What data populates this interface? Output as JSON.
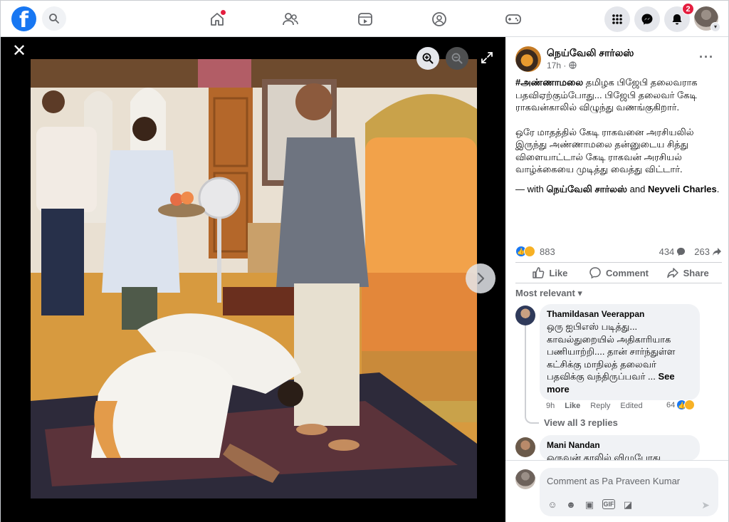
{
  "topbar": {
    "logo_letter": "f",
    "notification_count": "2"
  },
  "viewer": {
    "close_symbol": "✕"
  },
  "post": {
    "author": "நெய்வேலி சார்லஸ்",
    "time": "17h ·",
    "more": "···",
    "hashtag": "#அண்ணாமலை",
    "line1_rest": " தமிழக பிஜேபி தலைவராக பதவிஏற்கும்போது... பிஜேபி தலைவர் கேடி ராகவன்காலில் விழுந்து வணங்குகிறார்.",
    "paragraph2": "ஒரே மாதத்தில் கேடி ராகவனை அரசியலில் இருந்து அண்ணாமலை தன்னுடைய சித்து விளையாட்டால் கேடி ராகவன் அரசியல் வாழ்க்கையை முடித்து வைத்து விட்டார்.",
    "with_prefix": "— with ",
    "with_name": "நெய்வேலி சார்லஸ்",
    "with_and": " and ",
    "with_name2": "Neyveli Charles",
    "with_end": "."
  },
  "stats": {
    "reactions": "883",
    "comments": "434",
    "shares": "263"
  },
  "actions": {
    "like": "Like",
    "comment": "Comment",
    "share": "Share"
  },
  "sort_label": "Most relevant ▾",
  "comments": [
    {
      "name": "Thamildasan Veerappan",
      "text": "ஒரு ஐபிஎஸ் படித்து... காவல்துறையில் அதிகாரியாக பணியாற்றி.... தான் சார்ந்துள்ள கட்சிக்கு மாநிலத் தலைவர் பதவிக்கு வந்திருப்பவர் ...",
      "see_more": " See more",
      "time": "9h",
      "like": "Like",
      "reply": "Reply",
      "edited": "Edited",
      "reactions": "64",
      "view_replies": "View all 3 replies"
    },
    {
      "name": "Mani Nandan",
      "text": "ஒருவன் காலில் விழுபோது"
    }
  ],
  "composer": {
    "placeholder": "Comment as Pa Praveen Kumar"
  },
  "colors": {
    "brand": "#1877f2",
    "alert": "#e41e3f",
    "secondary_text": "#65676b"
  }
}
